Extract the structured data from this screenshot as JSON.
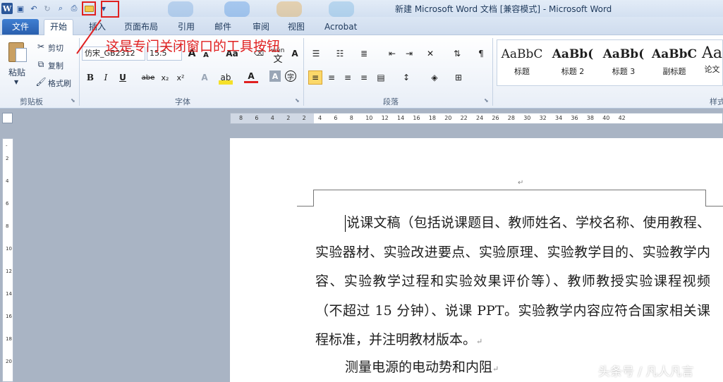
{
  "title": "新建 Microsoft Word 文档 [兼容模式] - Microsoft Word",
  "qat": {
    "logo": "W",
    "icons": [
      "save-icon",
      "undo-icon",
      "redo-icon",
      "print-preview-icon",
      "print-icon",
      "close-window-icon",
      "customize-dropdown-icon"
    ]
  },
  "tabs": [
    "文件",
    "开始",
    "插入",
    "页面布局",
    "引用",
    "邮件",
    "审阅",
    "视图",
    "Acrobat"
  ],
  "clipboard": {
    "paste": "粘贴",
    "cut": "剪切",
    "copy": "复制",
    "format_painter": "格式刷",
    "group": "剪贴板"
  },
  "font": {
    "name": "仿宋_GB2312",
    "size": "15.5",
    "group": "字体",
    "bold": "B",
    "italic": "I",
    "underline": "U",
    "strike": "abe",
    "sub": "x₂",
    "sup": "x²",
    "grow": "A",
    "shrink": "A",
    "case": "Aa",
    "wen": "wén",
    "wen2": "文",
    "color_a": "A",
    "char_shade": "A",
    "enclose": "字"
  },
  "paragraph": {
    "group": "段落"
  },
  "styles": {
    "items": [
      {
        "sample": "AaBbC",
        "name": "标题"
      },
      {
        "sample": "AaBb(",
        "name": "标题 2"
      },
      {
        "sample": "AaBb(",
        "name": "标题 3"
      },
      {
        "sample": "AaBbC",
        "name": "副标题"
      },
      {
        "sample": "Aa",
        "name": "论文"
      }
    ],
    "group": "样式"
  },
  "ruler": {
    "ticks": [
      "8",
      "6",
      "4",
      "2",
      "2",
      "4",
      "6",
      "8",
      "10",
      "12",
      "14",
      "16",
      "18",
      "20",
      "22",
      "24",
      "26",
      "28",
      "30",
      "32",
      "34",
      "36",
      "38",
      "40",
      "42"
    ]
  },
  "annotation": "这是专门关闭窗口的工具按钮",
  "document": {
    "paragraph1": "说课文稿（包括说课题目、教师姓名、学校名称、使用教程、实验器材、实验改进要点、实验原理、实验教学目的、实验教学内容、实验教学过程和实验效果评价等）、教师教授实验课程视频（不超过 15 分钟）、说课 PPT。实验教学内容应符合国家相关课程标准，并注明教材版本。",
    "paragraph2": "测量电源的电动势和内阻",
    "para_mark": "↵"
  },
  "watermark": "头条号 / 凡人凡言",
  "colors": {
    "file_tab": "#2a5fae",
    "annotation": "#e02020",
    "highlight": "#fbd86a"
  }
}
